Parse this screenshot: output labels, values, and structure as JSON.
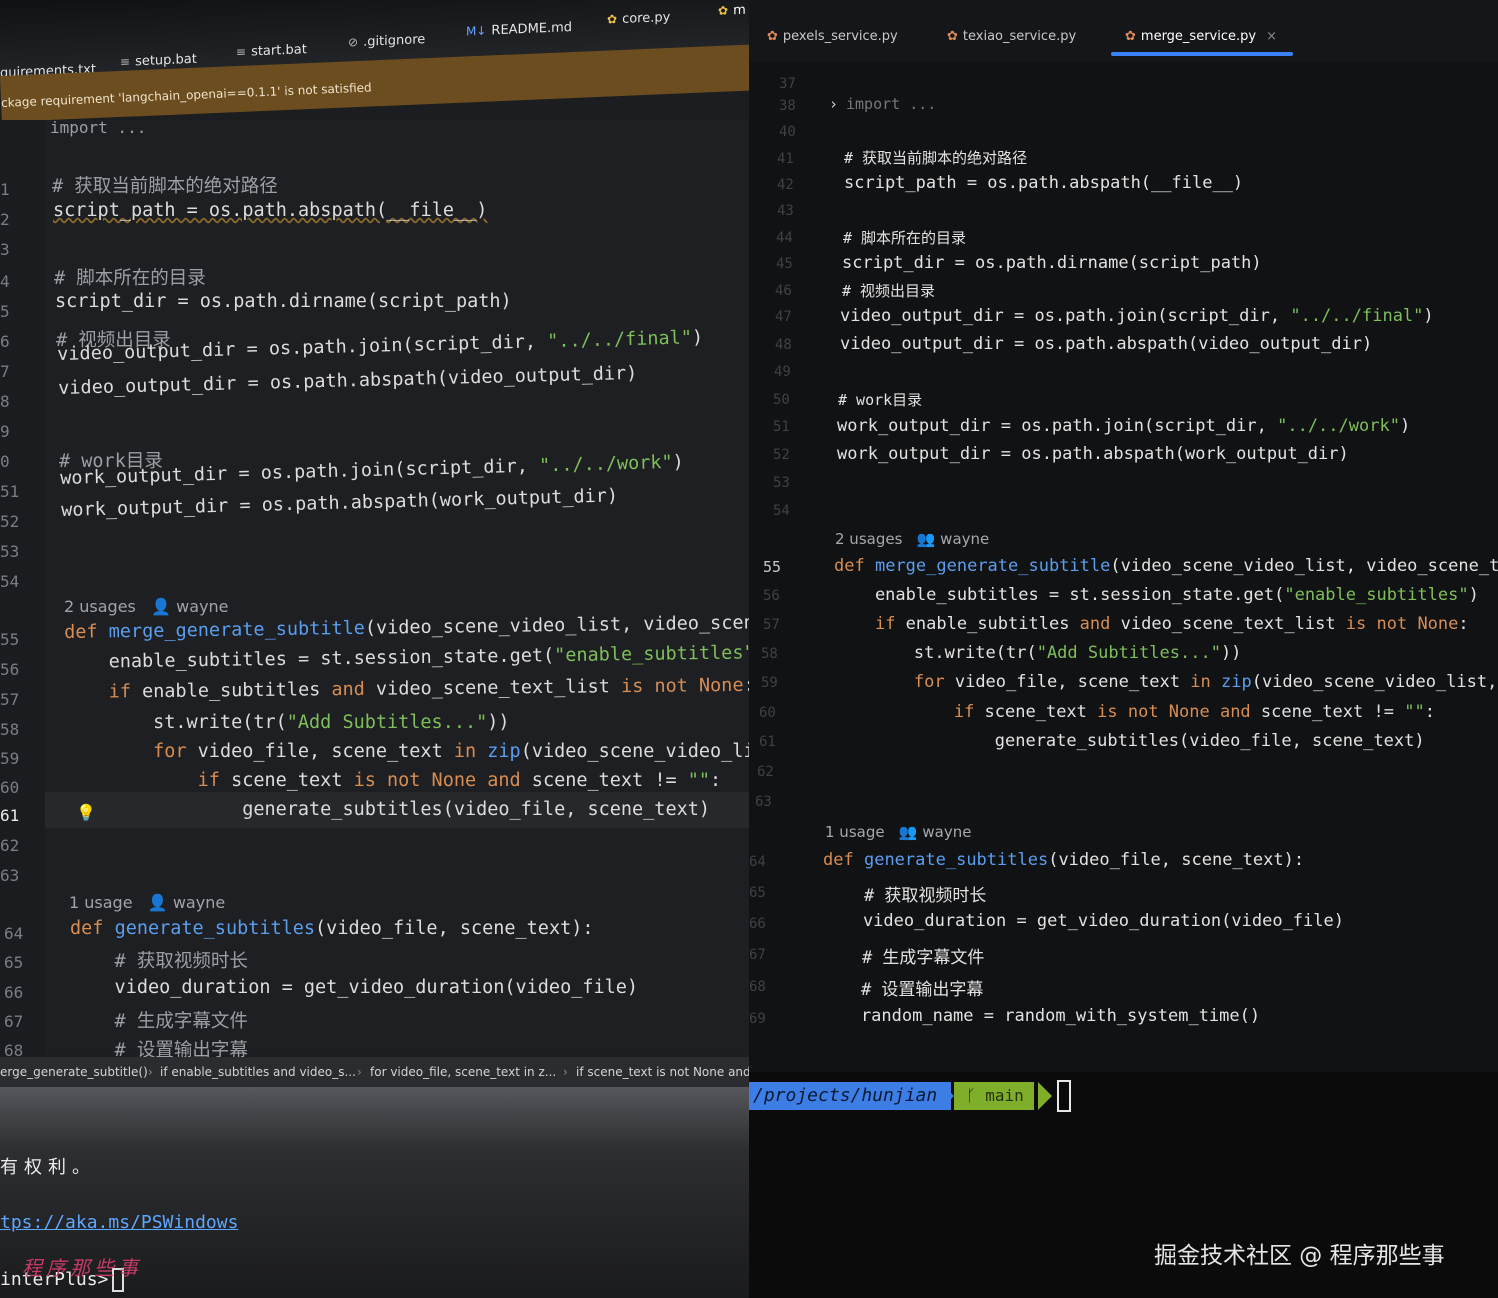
{
  "left": {
    "tabs": [
      {
        "label": "quirements.txt",
        "icon": "text-file-icon"
      },
      {
        "label": "setup.bat",
        "icon": "lines-icon"
      },
      {
        "label": "start.bat",
        "icon": "lines-icon"
      },
      {
        "label": ".gitignore",
        "icon": "ignore-icon"
      },
      {
        "label": "README.md",
        "icon": "markdown-icon"
      },
      {
        "label": "core.py",
        "icon": "python-icon"
      },
      {
        "label": "m",
        "icon": "python-icon"
      }
    ],
    "warning": "ckage requirement 'langchain_openai==0.1.1' is not satisfied",
    "lines": [
      {
        "num": "",
        "text": "import ..."
      },
      {
        "num": "1",
        "text": "# 获取当前脚本的绝对路径"
      },
      {
        "num": "2",
        "text": "script_path = os.path.abspath(__file__)"
      },
      {
        "num": "3",
        "text": ""
      },
      {
        "num": "4",
        "text": "# 脚本所在的目录"
      },
      {
        "num": "5",
        "text": "script_dir = os.path.dirname(script_path)"
      },
      {
        "num": "6",
        "text": "# 视频出目录"
      },
      {
        "num": "7",
        "text": "video_output_dir = os.path.join(script_dir, \"../../final\")"
      },
      {
        "num": "8",
        "text": "video_output_dir = os.path.abspath(video_output_dir)"
      },
      {
        "num": "9",
        "text": ""
      },
      {
        "num": "0",
        "text": "# work目录"
      },
      {
        "num": "51",
        "text": "work_output_dir = os.path.join(script_dir, \"../../work\")"
      },
      {
        "num": "52",
        "text": "work_output_dir = os.path.abspath(work_output_dir)"
      },
      {
        "num": "53",
        "text": ""
      },
      {
        "num": "54",
        "text": ""
      },
      {
        "num": "55",
        "text": "def merge_generate_subtitle(video_scene_video_list, video_scene_te"
      },
      {
        "num": "56",
        "text": "    enable_subtitles = st.session_state.get(\"enable_subtitles\")"
      },
      {
        "num": "57",
        "text": "    if enable_subtitles and video_scene_text_list is not None:"
      },
      {
        "num": "58",
        "text": "        st.write(tr(\"Add Subtitles...\"))"
      },
      {
        "num": "59",
        "text": "        for video_file, scene_text in zip(video_scene_video_list,"
      },
      {
        "num": "60",
        "text": "            if scene_text is not None and scene_text != \"\":"
      },
      {
        "num": "61",
        "text": "                generate_subtitles(video_file, scene_text)"
      },
      {
        "num": "62",
        "text": ""
      },
      {
        "num": "63",
        "text": ""
      },
      {
        "num": "64",
        "text": "def generate_subtitles(video_file, scene_text):"
      },
      {
        "num": "65",
        "text": "    # 获取视频时长"
      },
      {
        "num": "66",
        "text": "    video_duration = get_video_duration(video_file)"
      },
      {
        "num": "67",
        "text": "    # 生成字幕文件"
      },
      {
        "num": "68",
        "text": "    # 设置输出字幕"
      }
    ],
    "usages_merge": "2 usages",
    "usages_generate": "1 usage",
    "author": "wayne",
    "breadcrumb": [
      "erge_generate_subtitle()",
      "if enable_subtitles and video_s...",
      "for video_file, scene_text in z...",
      "if scene_text is not None and"
    ],
    "terminal": {
      "line1": "有权利。",
      "link": "tps://aka.ms/PSWindows",
      "prompt": "interPlus>",
      "watermark": "程序那些事"
    }
  },
  "right": {
    "tabs": [
      {
        "label": "pexels_service.py",
        "icon": "python-icon"
      },
      {
        "label": "texiao_service.py",
        "icon": "python-icon"
      },
      {
        "label": "merge_service.py",
        "icon": "python-icon",
        "close": "×"
      }
    ],
    "lines": [
      {
        "num": "37",
        "text": ""
      },
      {
        "num": "38",
        "text": "import ..."
      },
      {
        "num": "40",
        "text": ""
      },
      {
        "num": "41",
        "text": "# 获取当前脚本的绝对路径"
      },
      {
        "num": "42",
        "text": "script_path = os.path.abspath(__file__)"
      },
      {
        "num": "43",
        "text": ""
      },
      {
        "num": "44",
        "text": "# 脚本所在的目录"
      },
      {
        "num": "45",
        "text": "script_dir = os.path.dirname(script_path)"
      },
      {
        "num": "46",
        "text": "# 视频出目录"
      },
      {
        "num": "47",
        "text": "video_output_dir = os.path.join(script_dir, \"../../final\")"
      },
      {
        "num": "48",
        "text": "video_output_dir = os.path.abspath(video_output_dir)"
      },
      {
        "num": "49",
        "text": ""
      },
      {
        "num": "50",
        "text": "# work目录"
      },
      {
        "num": "51",
        "text": "work_output_dir = os.path.join(script_dir, \"../../work\")"
      },
      {
        "num": "52",
        "text": "work_output_dir = os.path.abspath(work_output_dir)"
      },
      {
        "num": "53",
        "text": ""
      },
      {
        "num": "54",
        "text": ""
      },
      {
        "num": "55",
        "text": "def merge_generate_subtitle(video_scene_video_list, video_scene_te"
      },
      {
        "num": "56",
        "text": "    enable_subtitles = st.session_state.get(\"enable_subtitles\")"
      },
      {
        "num": "57",
        "text": "    if enable_subtitles and video_scene_text_list is not None:"
      },
      {
        "num": "58",
        "text": "        st.write(tr(\"Add Subtitles...\"))"
      },
      {
        "num": "59",
        "text": "        for video_file, scene_text in zip(video_scene_video_list,"
      },
      {
        "num": "60",
        "text": "            if scene_text is not None and scene_text != \"\":"
      },
      {
        "num": "61",
        "text": "                generate_subtitles(video_file, scene_text)"
      },
      {
        "num": "62",
        "text": ""
      },
      {
        "num": "63",
        "text": ""
      },
      {
        "num": "64",
        "text": "def generate_subtitles(video_file, scene_text):"
      },
      {
        "num": "65",
        "text": "    # 获取视频时长"
      },
      {
        "num": "66",
        "text": "    video_duration = get_video_duration(video_file)"
      },
      {
        "num": "67",
        "text": "    # 生成字幕文件"
      },
      {
        "num": "68",
        "text": "    # 设置输出字幕"
      },
      {
        "num": "69",
        "text": "    random_name = random_with_system_time()"
      }
    ],
    "usages_merge": "2 usages",
    "usages_generate": "1 usage",
    "author": "wayne",
    "terminal": {
      "path": "/projects/hunjian",
      "branch": "main",
      "branch_icon": "git-branch-icon"
    },
    "watermark": "掘金技术社区 @ 程序那些事"
  },
  "colors": {
    "keyword": "#d88d52",
    "function": "#5a9ef0",
    "string": "#7fbf5a",
    "comment": "#9c9ea3",
    "tab_accent": "#3b82f6",
    "warning_bg": "#6b4d1f",
    "powerline_path": "#3c7de6",
    "powerline_branch": "#7fae2a"
  }
}
